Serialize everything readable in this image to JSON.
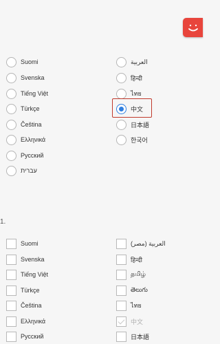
{
  "header": {
    "logo_icon": "smiley-logo-icon",
    "accent": "#e8453c"
  },
  "interface_languages": {
    "left": [
      "Suomi",
      "Svenska",
      "Tiếng Việt",
      "Türkçe",
      "Čeština",
      "Ελληνικά",
      "Русский",
      "עברית"
    ],
    "right": [
      "العربية",
      "हिन्दी",
      "ไทย",
      "中文",
      "日本語",
      "한국어"
    ],
    "selected": "中文"
  },
  "section_mark": "1.",
  "search_languages": {
    "left": [
      "Suomi",
      "Svenska",
      "Tiếng Việt",
      "Türkçe",
      "Čeština",
      "Ελληνικά",
      "Русский"
    ],
    "right": [
      "العربية (مصر)",
      "हिन्दी",
      "தமிழ்",
      "తెలుగు",
      "ไทย",
      "中文",
      "日本語"
    ],
    "checked": "中文"
  }
}
